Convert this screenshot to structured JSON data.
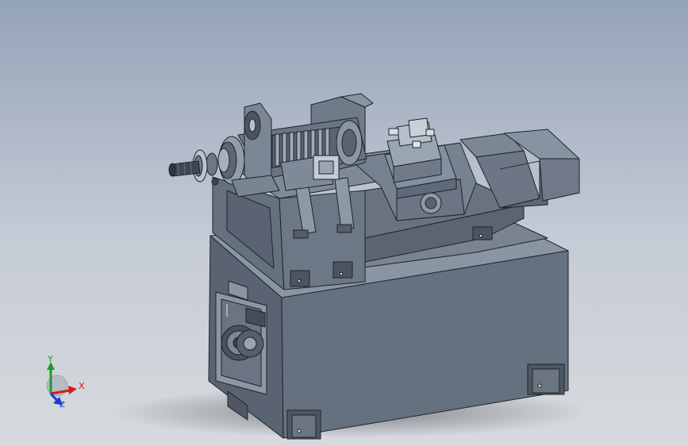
{
  "viewport": {
    "background_top": "#95a3b8",
    "background_bottom": "#d7dadd",
    "model": {
      "subject": "cnc-lathe-assembly",
      "body_color": "#5e6876",
      "edge_color": "#1d232b"
    }
  },
  "triad": {
    "x_label": "X",
    "y_label": "Y",
    "z_label": "Z",
    "x_color": "#d11c1c",
    "y_color": "#1e9a28",
    "z_color": "#1a3bd1"
  }
}
